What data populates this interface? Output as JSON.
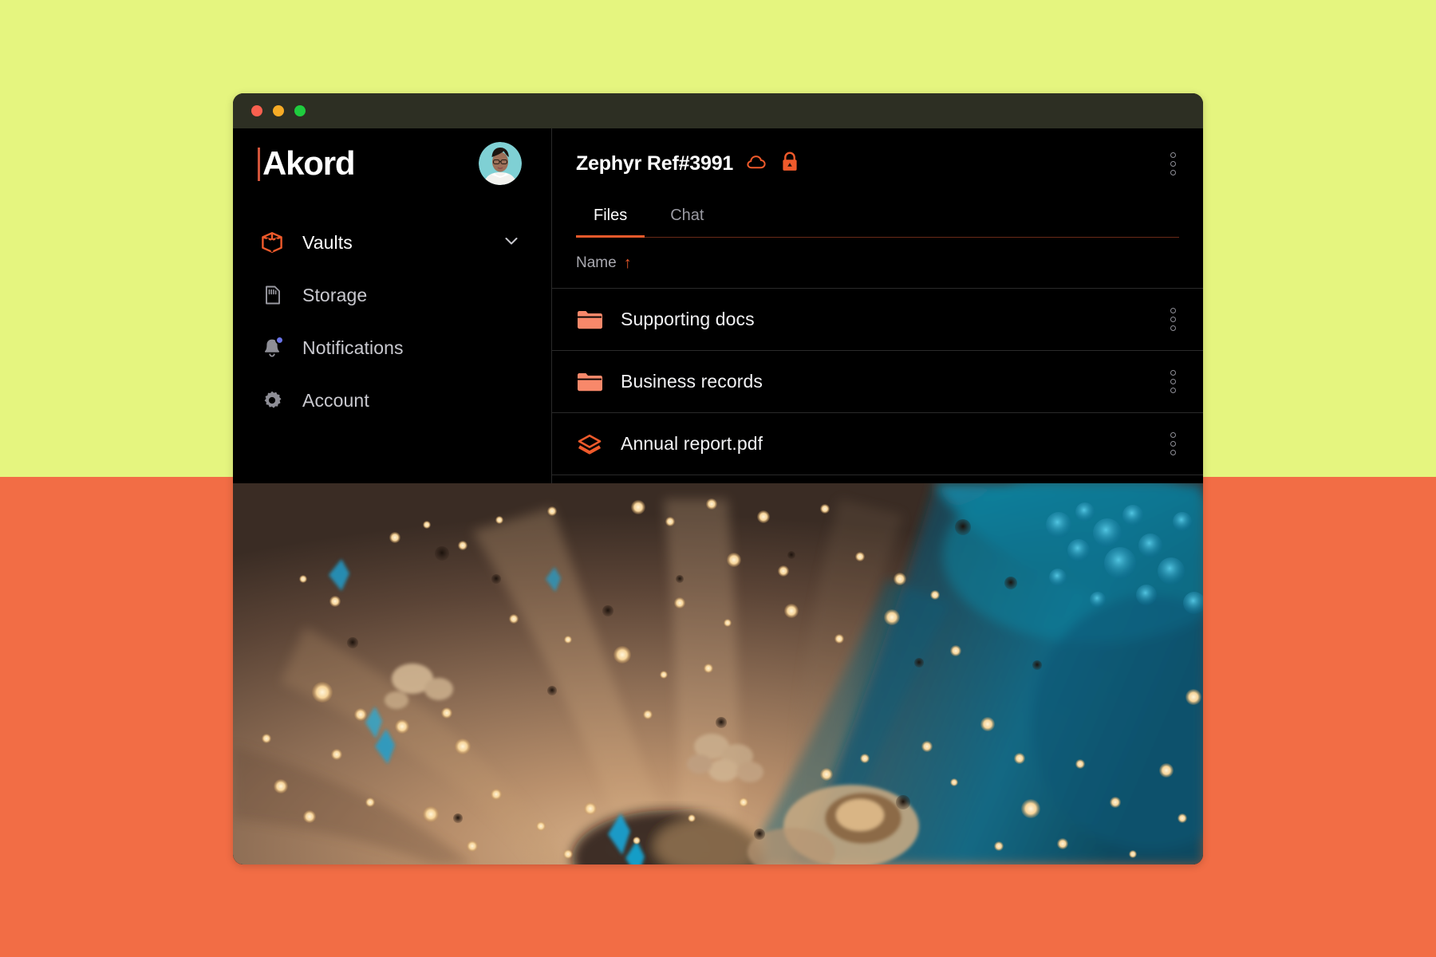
{
  "window": {
    "traffic_lights": [
      "close",
      "minimize",
      "maximize"
    ],
    "titlebar_color": "#2d2f23"
  },
  "background": {
    "top_color": "#e5f57f",
    "bottom_color": "#f26d45"
  },
  "theme": {
    "accent": "#ef5a2b",
    "folder": "#f8886a",
    "surface": "#000000",
    "text_primary": "#ffffff",
    "text_secondary": "#9a9aa2",
    "badge": "#6a74e8"
  },
  "sidebar": {
    "logo": {
      "text": "Akord",
      "bar_color": "#d1543a"
    },
    "avatar": {
      "icon": "user-avatar",
      "background": "#79cfd4"
    },
    "items": [
      {
        "label": "Vaults",
        "icon": "cube-icon",
        "active": true,
        "expandable": true,
        "badge": false
      },
      {
        "label": "Storage",
        "icon": "storage-card-icon",
        "active": false,
        "expandable": false,
        "badge": false
      },
      {
        "label": "Notifications",
        "icon": "bell-icon",
        "active": false,
        "expandable": false,
        "badge": true
      },
      {
        "label": "Account",
        "icon": "gear-icon",
        "active": false,
        "expandable": false,
        "badge": false
      }
    ],
    "chevron_icon": "chevron-down-icon"
  },
  "main": {
    "vault": {
      "title": "Zephyr Ref#3991",
      "cloud_icon": "cloud-icon",
      "lock_icon": "lock-icon"
    },
    "overflow_icon": "kebab-menu-icon",
    "tabs": [
      {
        "label": "Files",
        "active": true
      },
      {
        "label": "Chat",
        "active": false
      }
    ],
    "columns": [
      {
        "label": "Name",
        "sort": "ascending",
        "sort_icon": "arrow-up-icon"
      }
    ],
    "files": [
      {
        "name": "Supporting docs",
        "icon": "folder-icon",
        "type": "folder"
      },
      {
        "name": "Business records",
        "icon": "folder-icon",
        "type": "folder"
      },
      {
        "name": "Annual report.pdf",
        "icon": "layers-icon",
        "type": "file"
      }
    ]
  },
  "artwork": {
    "name": "abstract-fluid-art",
    "description": "Abstract oil-and-water fluid art with golden bokeh droplets over warm tan and deep teal swirls"
  }
}
